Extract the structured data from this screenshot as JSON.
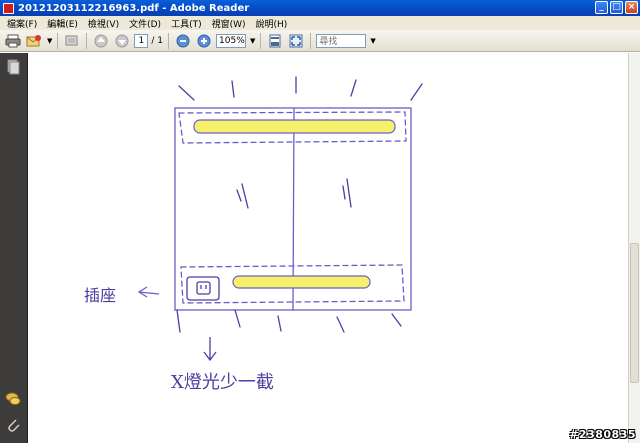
{
  "window": {
    "title": "20121203112216963.pdf - Adobe Reader",
    "minimize": "_",
    "maximize": "□",
    "close": "×"
  },
  "menu": {
    "items": [
      "檔案(F)",
      "編輯(E)",
      "檢視(V)",
      "文件(D)",
      "工具(T)",
      "視窗(W)",
      "說明(H)"
    ]
  },
  "toolbar": {
    "page_current": "1",
    "page_total": "/ 1",
    "zoom": "105%",
    "find_placeholder": "尋找"
  },
  "document": {
    "label_socket": "插座",
    "label_lamp": "X燈光少一截"
  },
  "watermark": "#2380835",
  "colors": {
    "sketch_line": "#6a5fc6",
    "highlight": "#f7f06a",
    "title_bar": "#0449c2"
  }
}
